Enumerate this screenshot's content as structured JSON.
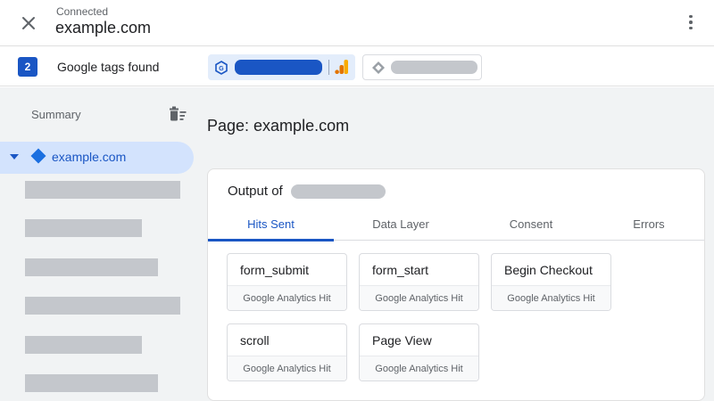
{
  "header": {
    "status": "Connected",
    "domain": "example.com"
  },
  "tags_bar": {
    "count": "2",
    "label": "Google tags found"
  },
  "sidebar": {
    "summary_label": "Summary",
    "page_item": "example.com",
    "redacted_rows": 6
  },
  "main": {
    "page_title": "Page: example.com",
    "output_label": "Output of",
    "tabs": [
      {
        "label": "Hits Sent",
        "active": true
      },
      {
        "label": "Data Layer",
        "active": false
      },
      {
        "label": "Consent",
        "active": false
      },
      {
        "label": "Errors",
        "active": false
      }
    ],
    "hits": [
      {
        "name": "form_submit",
        "type": "Google Analytics Hit"
      },
      {
        "name": "form_start",
        "type": "Google Analytics Hit"
      },
      {
        "name": "Begin Checkout",
        "type": "Google Analytics Hit"
      },
      {
        "name": "scroll",
        "type": "Google Analytics Hit"
      },
      {
        "name": "Page View",
        "type": "Google Analytics Hit"
      }
    ]
  },
  "icons": {
    "close": "close-icon",
    "more": "more-vert-icon",
    "delete": "delete-sweep-icon",
    "google_tag": "google-tag-icon",
    "analytics": "google-analytics-icon",
    "tag_manager": "tag-manager-icon"
  },
  "colors": {
    "accent": "#1a56c4",
    "selected_bg": "#d3e3fd",
    "chip_bg": "#e3edfb",
    "redaction": "#c4c7cc",
    "analytics_orange": "#f9ab00",
    "analytics_dark": "#e37400"
  }
}
